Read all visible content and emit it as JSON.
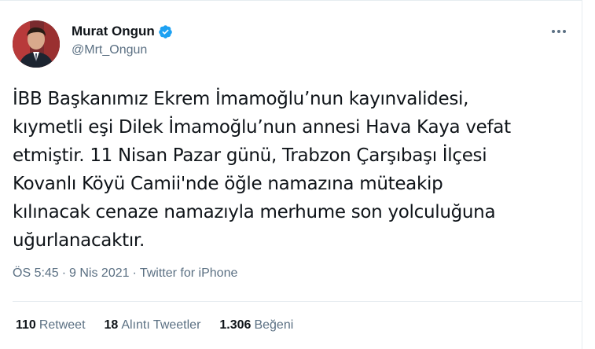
{
  "author": {
    "name": "Murat Ongun",
    "handle": "@Mrt_Ongun",
    "verified_color": "#1da1f2"
  },
  "tweet": {
    "text": "İBB Başkanımız Ekrem İmamoğlu’nun kayınvalidesi,\nkıymetli eşi Dilek İmamoğlu’nun annesi Hava Kaya vefat\netmiştir. 11 Nisan Pazar günü, Trabzon Çarşıbaşı İlçesi\nKovanlı Köyü Camii'nde öğle namazına müteakip\nkılınacak cenaze namazıyla merhume son yolculuğuna\nuğurlanacaktır."
  },
  "meta": {
    "time": "ÖS 5:45",
    "separator1": "·",
    "date": "9 Nis 2021",
    "separator2": "·",
    "source": "Twitter for iPhone"
  },
  "stats": [
    {
      "count": "110",
      "label": "Retweet"
    },
    {
      "count": "18",
      "label": "Alıntı Tweetler"
    },
    {
      "count": "1.306",
      "label": "Beğeni"
    }
  ],
  "icons": {
    "more": "more-horizontal-icon",
    "verified": "verified-badge-icon"
  }
}
